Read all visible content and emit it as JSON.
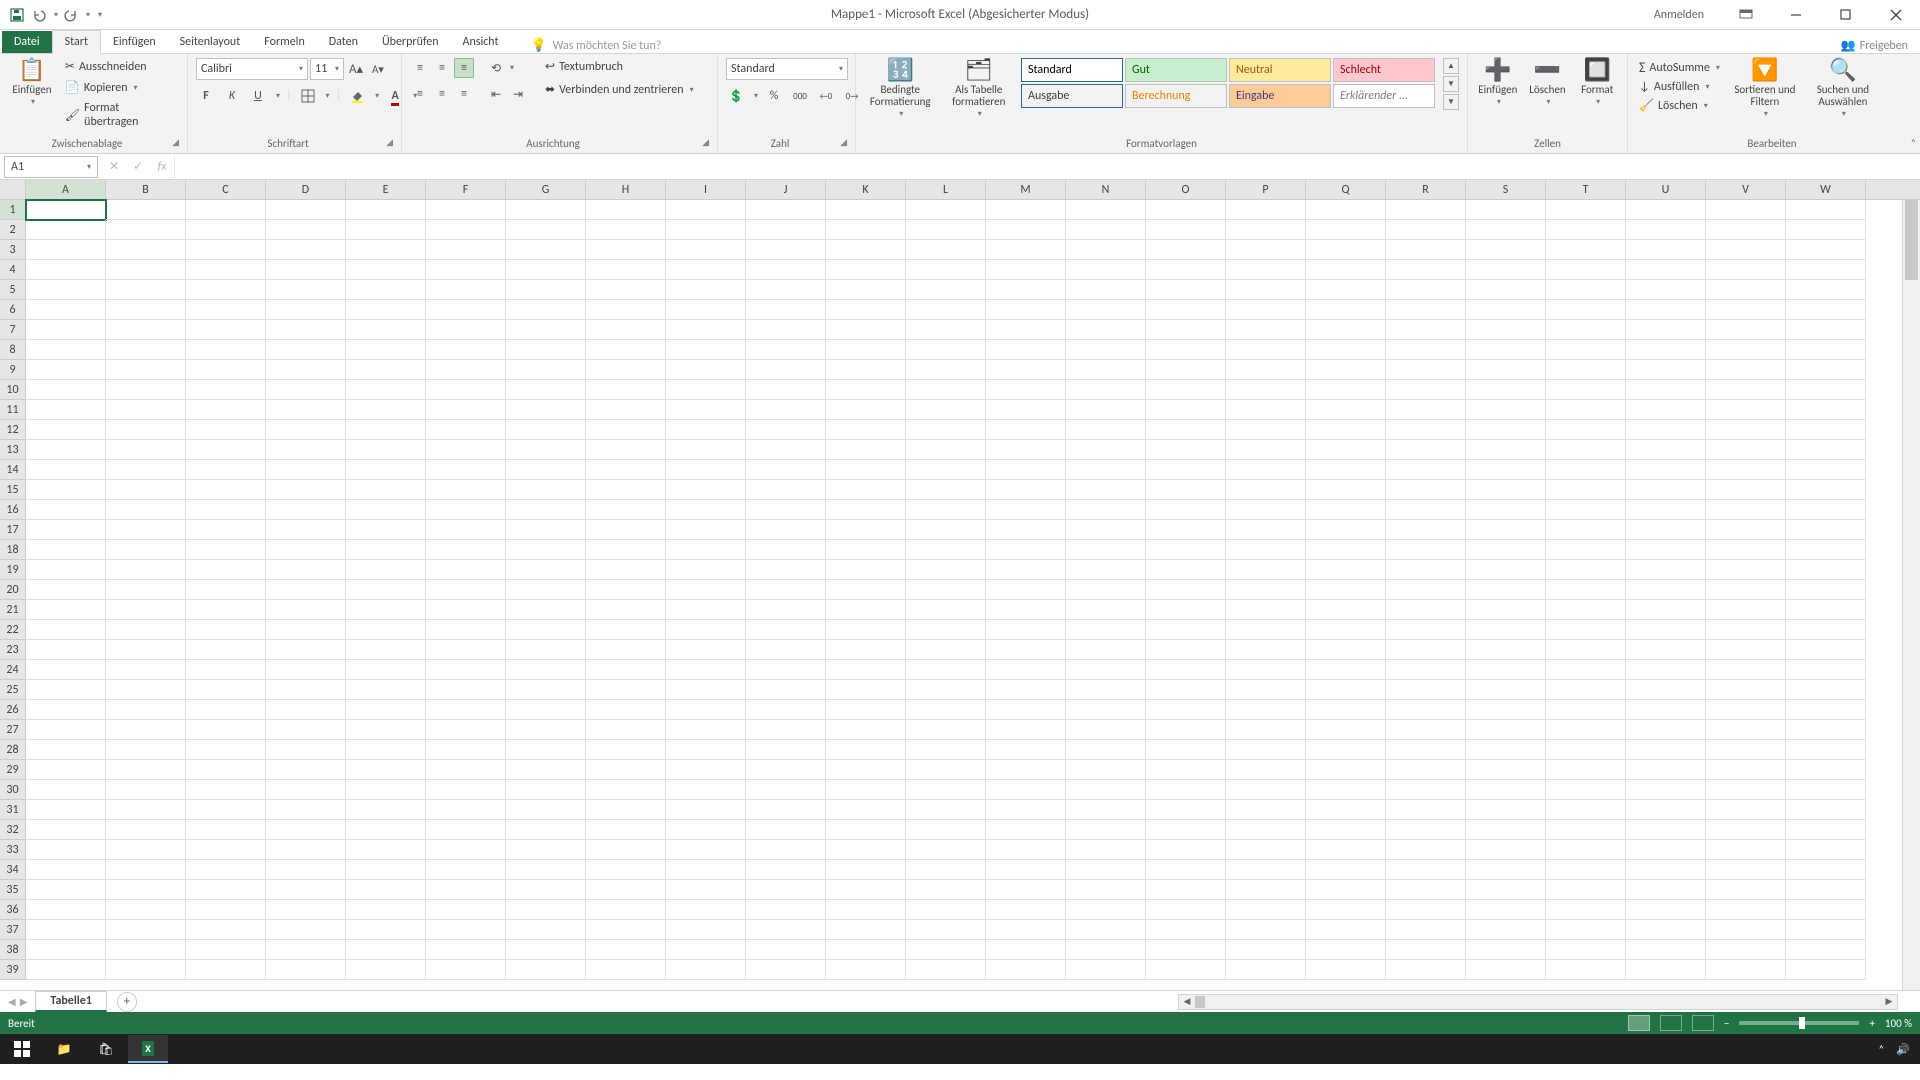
{
  "titlebar": {
    "title": "Mappe1  -  Microsoft Excel (Abgesicherter Modus)",
    "signin": "Anmelden"
  },
  "tabs": {
    "file": "Datei",
    "items": [
      "Start",
      "Einfügen",
      "Seitenlayout",
      "Formeln",
      "Daten",
      "Überprüfen",
      "Ansicht"
    ],
    "active": "Start",
    "tellme_placeholder": "Was möchten Sie tun?",
    "share": "Freigeben"
  },
  "clipboard": {
    "paste": "Einfügen",
    "cut": "Ausschneiden",
    "copy": "Kopieren",
    "format_painter": "Format übertragen",
    "label": "Zwischenablage"
  },
  "font": {
    "family": "Calibri",
    "size": "11",
    "label": "Schriftart"
  },
  "align": {
    "wrap": "Textumbruch",
    "merge": "Verbinden und zentrieren",
    "label": "Ausrichtung"
  },
  "number": {
    "format": "Standard",
    "label": "Zahl"
  },
  "styles": {
    "cond": "Bedingte\nFormatierung",
    "table": "Als Tabelle\nformatieren",
    "row1": [
      "Standard",
      "Gut",
      "Neutral",
      "Schlecht"
    ],
    "row2": [
      "Ausgabe",
      "Berechnung",
      "Eingabe",
      "Erklärender ..."
    ],
    "label": "Formatvorlagen"
  },
  "cells": {
    "insert": "Einfügen",
    "delete": "Löschen",
    "format": "Format",
    "label": "Zellen"
  },
  "editing": {
    "autosum": "AutoSumme",
    "fill": "Ausfüllen",
    "clear": "Löschen",
    "sort": "Sortieren und\nFiltern",
    "find": "Suchen und\nAuswählen",
    "label": "Bearbeiten"
  },
  "namebox": "A1",
  "columns": [
    "A",
    "B",
    "C",
    "D",
    "E",
    "F",
    "G",
    "H",
    "I",
    "J",
    "K",
    "L",
    "M",
    "N",
    "O",
    "P",
    "Q",
    "R",
    "S",
    "T",
    "U",
    "V",
    "W"
  ],
  "row_count": 39,
  "sheet": {
    "tab": "Tabelle1"
  },
  "status": {
    "ready": "Bereit",
    "zoom": "100 %"
  },
  "style_colors": {
    "Standard": {
      "bg": "#ffffff",
      "fg": "#000000",
      "border": "#2a6b8f"
    },
    "Gut": {
      "bg": "#c6efce",
      "fg": "#006100"
    },
    "Neutral": {
      "bg": "#ffeb9c",
      "fg": "#9c5700"
    },
    "Schlecht": {
      "bg": "#ffc7ce",
      "fg": "#9c0006"
    },
    "Ausgabe": {
      "bg": "#f2f2f2",
      "fg": "#3f3f3f",
      "border": "#2a6b8f"
    },
    "Berechnung": {
      "bg": "#f2f2f2",
      "fg": "#fa7d00"
    },
    "Eingabe": {
      "bg": "#ffcc99",
      "fg": "#3f3f76"
    },
    "Erklärender ...": {
      "bg": "#ffffff",
      "fg": "#7f7f7f",
      "italic": true
    }
  }
}
